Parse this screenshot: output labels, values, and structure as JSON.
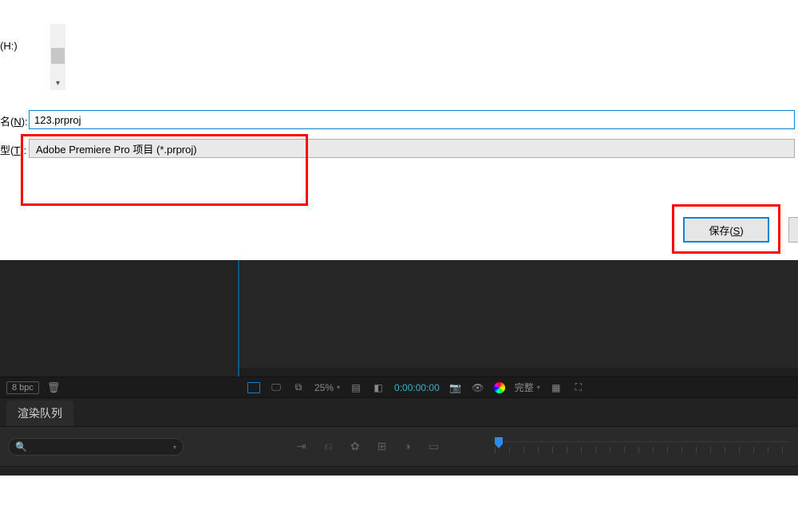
{
  "dialog": {
    "drive_label": "(H:)",
    "filename_label_prefix": "名(",
    "filename_label_accel": "N",
    "filename_label_suffix": "):",
    "filename_value": "123.prproj",
    "filetype_label_prefix": "型(",
    "filetype_label_accel": "T",
    "filetype_label_suffix": "):",
    "filetype_value": "Adobe Premiere Pro 项目 (*.prproj)",
    "save_label_prefix": "保存(",
    "save_label_accel": "S",
    "save_label_suffix": ")"
  },
  "ae": {
    "project_footer": {
      "bpc": "8 bpc",
      "trash_glyph": "🗑"
    },
    "viewer_footer": {
      "zoom": "25%",
      "timecode": "0:00:00:00",
      "quality": "完整",
      "camera_glyph": "📷",
      "monitor_glyph": "🖵",
      "mask_glyph": "⧉",
      "alpha_glyph": "◧",
      "grid_glyph": "▦",
      "screen_glyph": "⛶",
      "layers_glyph": "▤"
    },
    "render_queue": {
      "tab_label": "渲染队列",
      "search_glyph": "🔍",
      "chev_glyph": "▾",
      "icons": {
        "i1": "⇥",
        "i2": "⎌",
        "i3": "✿",
        "i4": "⊞",
        "i5": "◑",
        "i6": "▭"
      }
    }
  }
}
